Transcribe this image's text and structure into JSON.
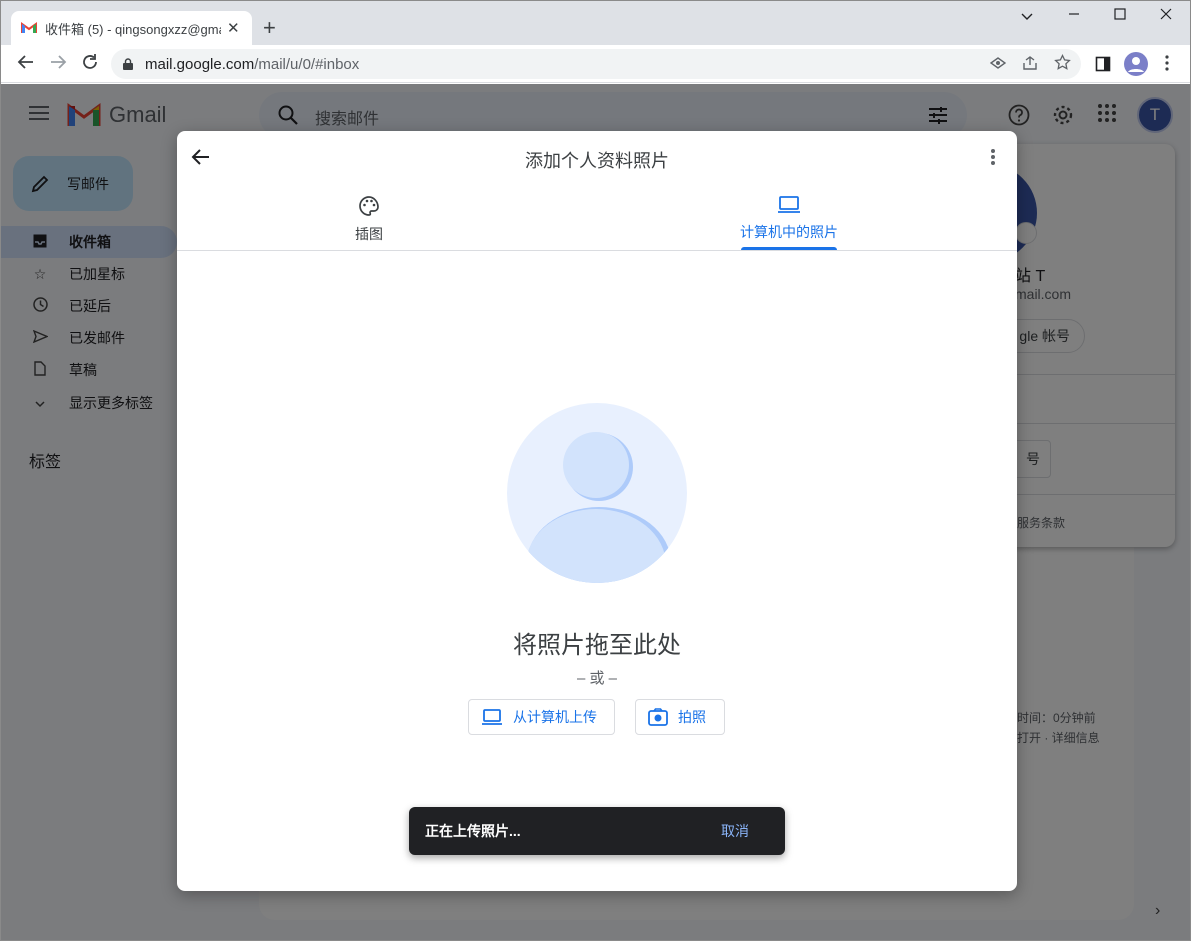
{
  "browser": {
    "tab_title": "收件箱 (5) - qingsongxzz@gma",
    "url_host": "mail.google.com",
    "url_path": "/mail/u/0/#inbox"
  },
  "gmail": {
    "app_name": "Gmail",
    "search_placeholder": "搜索邮件",
    "avatar_letter": "T",
    "compose_label": "写邮件",
    "nav": [
      {
        "label": "收件箱",
        "icon": "inbox-icon"
      },
      {
        "label": "已加星标",
        "icon": "star-icon"
      },
      {
        "label": "已延后",
        "icon": "clock-icon"
      },
      {
        "label": "已发邮件",
        "icon": "send-icon"
      },
      {
        "label": "草稿",
        "icon": "draft-icon"
      },
      {
        "label": "显示更多标签",
        "icon": "chevron-down-icon"
      }
    ],
    "labels_heading": "标签",
    "footer_activity": "时间：0分钟前",
    "footer_details": "打开 · 详细信息"
  },
  "account_popover": {
    "name": "站 T",
    "email": "mail.com",
    "manage_button": "gle 帐号",
    "second_button": "号",
    "terms": "服务条款"
  },
  "dialog": {
    "title": "添加个人资料照片",
    "tabs": [
      {
        "label": "插图",
        "icon": "palette-icon",
        "active": false
      },
      {
        "label": "计算机中的照片",
        "icon": "laptop-icon",
        "active": true
      }
    ],
    "drop_text": "将照片拖至此处",
    "or_text": "– 或 –",
    "upload_button": "从计算机上传",
    "photo_button": "拍照"
  },
  "snackbar": {
    "message": "正在上传照片...",
    "action": "取消"
  },
  "colors": {
    "accent": "#1a73e8",
    "scrim": "rgba(0,0,0,0.5)",
    "snackbar_bg": "#202124",
    "avatar_bg": "#3b57a8"
  }
}
